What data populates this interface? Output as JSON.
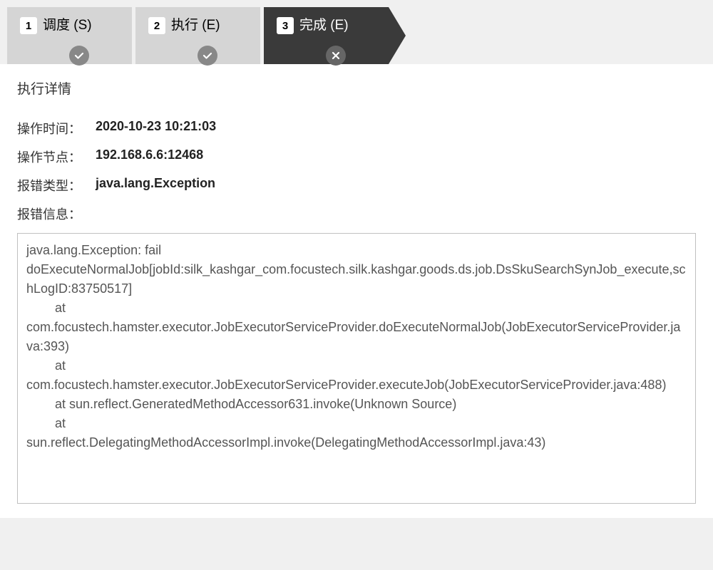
{
  "tabs": [
    {
      "number": "1",
      "label": "调度 (S)",
      "status": "check"
    },
    {
      "number": "2",
      "label": "执行 (E)",
      "status": "check"
    },
    {
      "number": "3",
      "label": "完成 (E)",
      "status": "close"
    }
  ],
  "section_title": "执行详情",
  "details": {
    "time_label": "操作时间：",
    "time_value": "2020-10-23 10:21:03",
    "node_label": "操作节点：",
    "node_value": "192.168.6.6:12468",
    "error_type_label": "报错类型：",
    "error_type_value": "java.lang.Exception",
    "error_info_label": "报错信息："
  },
  "error_message": "java.lang.Exception: fail\ndoExecuteNormalJob[jobId:silk_kashgar_com.focustech.silk.kashgar.goods.ds.job.DsSkuSearchSynJob_execute,schLogID:83750517]\n        at\ncom.focustech.hamster.executor.JobExecutorServiceProvider.doExecuteNormalJob(JobExecutorServiceProvider.java:393)\n        at\ncom.focustech.hamster.executor.JobExecutorServiceProvider.executeJob(JobExecutorServiceProvider.java:488)\n        at sun.reflect.GeneratedMethodAccessor631.invoke(Unknown Source)\n        at\nsun.reflect.DelegatingMethodAccessorImpl.invoke(DelegatingMethodAccessorImpl.java:43)"
}
